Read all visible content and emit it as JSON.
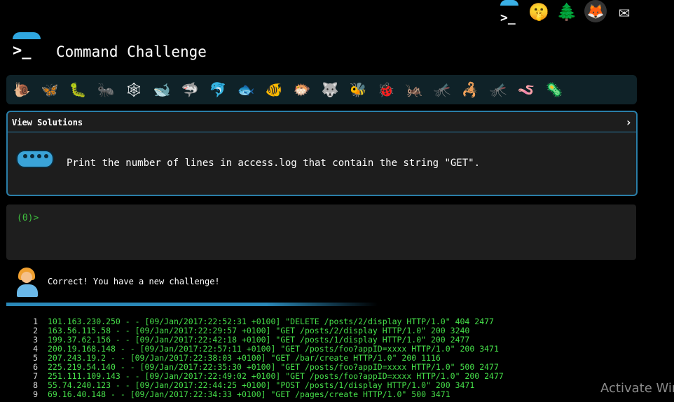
{
  "header": {
    "title": "Command Challenge",
    "icons": [
      "terminal-icon",
      "shushing-face-icon",
      "tree-icon",
      "gitlab-icon",
      "mail-icon"
    ]
  },
  "creatures": [
    "🐌",
    "🦋",
    "🐛",
    "🐜",
    "🕸",
    "🐋",
    "🦈",
    "🐬",
    "🐟",
    "🐠",
    "🐡",
    "🐺",
    "🐝",
    "🐞",
    "🦗",
    "🦟",
    "🦂",
    "🦟",
    "🪱",
    "🦠"
  ],
  "challenge": {
    "view_solutions": "View Solutions",
    "chevron": "›",
    "text": "Print the number of lines in access.log that contain the string \"GET\"."
  },
  "terminal": {
    "prompt": "(0)>"
  },
  "feedback": {
    "message": "Correct! You have a new challenge!"
  },
  "log": [
    {
      "n": "1",
      "text": "101.163.230.250 - - [09/Jan/2017:22:52:31 +0100] \"DELETE /posts/2/display HTTP/1.0\" 404 2477"
    },
    {
      "n": "2",
      "text": "163.56.115.58 - - [09/Jan/2017:22:29:57 +0100] \"GET /posts/2/display HTTP/1.0\" 200 3240"
    },
    {
      "n": "3",
      "text": "199.37.62.156 - - [09/Jan/2017:22:42:18 +0100] \"GET /posts/1/display HTTP/1.0\" 200 2477"
    },
    {
      "n": "4",
      "text": "200.19.168.148 - - [09/Jan/2017:22:57:11 +0100] \"GET /posts/foo?appID=xxxx HTTP/1.0\" 200 3471"
    },
    {
      "n": "5",
      "text": "207.243.19.2 - - [09/Jan/2017:22:38:03 +0100] \"GET /bar/create HTTP/1.0\" 200 1116"
    },
    {
      "n": "6",
      "text": "225.219.54.140 - - [09/Jan/2017:22:35:30 +0100] \"GET /posts/foo?appID=xxxx HTTP/1.0\" 500 2477"
    },
    {
      "n": "7",
      "text": "251.111.109.143 - - [09/Jan/2017:22:49:02 +0100] \"GET /posts/foo?appID=xxxx HTTP/1.0\" 200 2477"
    },
    {
      "n": "8",
      "text": "55.74.240.123 - - [09/Jan/2017:22:44:25 +0100] \"POST /posts/1/display HTTP/1.0\" 200 3471"
    },
    {
      "n": "9",
      "text": "69.16.40.148 - - [09/Jan/2017:22:34:33 +0100] \"GET /pages/create HTTP/1.0\" 500 3471"
    }
  ],
  "watermark": "Activate Win",
  "colors": {
    "accent": "#2a7ea8",
    "log_text": "#46e04a",
    "prompt": "#3fbf3f"
  }
}
